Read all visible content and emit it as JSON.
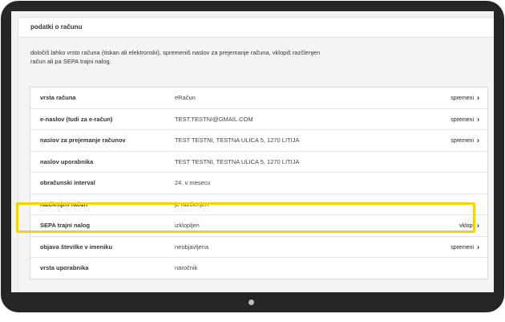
{
  "panel": {
    "title": "podatki o računu",
    "intro": "določiš lahko vrsto računa (tiskan ali elektronski), spremeniš naslov za prejemanje računa, vklopiš razčlenjen račun ali pa SEPA trajni nalog."
  },
  "rows": [
    {
      "label": "vrsta računa",
      "value": "eRačun",
      "action": "spremeni"
    },
    {
      "label": "e-naslov (tudi za e-račun)",
      "value": "TEST.TESTNI@GMAIL.COM",
      "action": "spremeni"
    },
    {
      "label": "naslov za prejemanje računov",
      "value": "TEST TESTNI, TESTNA ULICA 5, 1270 LITIJA",
      "action": "spremeni"
    },
    {
      "label": "naslov uporabnika",
      "value": "TEST TESTNI, TESTNA ULICA 5, 1270 LITIJA",
      "action": ""
    },
    {
      "label": "obračunski interval",
      "value": "24. v mesecu",
      "action": ""
    },
    {
      "label": "razčlenjen račun",
      "value": "je razčlenjen",
      "action": ""
    },
    {
      "label": "SEPA trajni nalog",
      "value": "izklopljen",
      "action": "vklopi"
    },
    {
      "label": "objava številke v imeniku",
      "value": "neobjavljena",
      "action": "spremeni"
    },
    {
      "label": "vrsta uporabnika",
      "value": "naročnik",
      "action": ""
    }
  ],
  "icons": {
    "action_arrow": "chevron-right-icon"
  },
  "colors": {
    "highlight": "#f7d300",
    "device": "#262626"
  }
}
